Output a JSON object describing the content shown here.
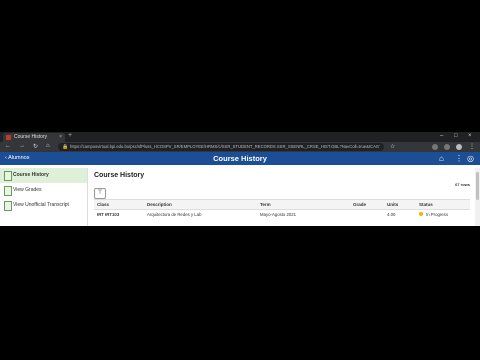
{
  "browser": {
    "tab_title": "Course History",
    "tab_close": "×",
    "new_tab": "+",
    "url": "https://campusvirtual.bpi.edu.bo/psc/sfPluss_HCOSPV_SR/EMPLOYEE/HRMS/c/SSR_STUDENT_RECORDS.SSR_SSENRL_CRSE_HIST.GBL?NavColl=true&ICAGTarget=start"
  },
  "app": {
    "back_label": "Alumnos",
    "title": "Course History"
  },
  "sidebar": {
    "items": [
      {
        "label": "Course History"
      },
      {
        "label": "View Grades"
      },
      {
        "label": "View Unofficial Transcript"
      }
    ]
  },
  "main": {
    "title": "Course History",
    "rows_label": "67 rows",
    "columns": [
      "Class",
      "Description",
      "Term",
      "Grade",
      "Units",
      "Status"
    ],
    "rows": [
      {
        "class": "IRT IRT103",
        "description": "Arquitectura de Redes y Lab",
        "term": "Mayo-Agosto 2021",
        "grade": "",
        "units": "4.00",
        "status": "In Progress"
      }
    ]
  },
  "colors": {
    "header_bg": "#1b4e94",
    "active_bg": "#dff0d8",
    "status_in_progress": "#f0b400"
  }
}
